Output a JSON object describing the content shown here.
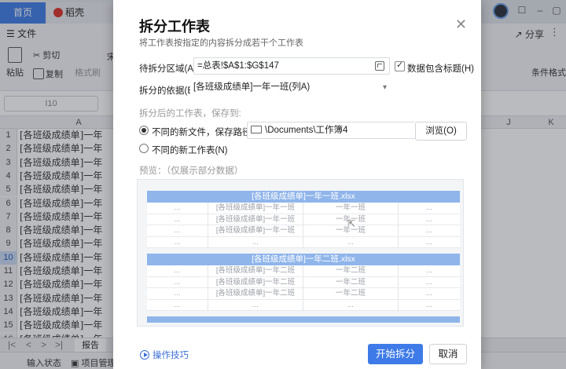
{
  "app": {
    "tabs": [
      {
        "label": "首页"
      },
      {
        "label": "稻壳"
      }
    ],
    "menu": {
      "file": "文件",
      "share": "分享"
    },
    "ribbon": {
      "paste": "粘贴",
      "cut": "剪切",
      "copy": "复制",
      "format_painter": "格式刷",
      "font_partial": "宋",
      "conditional_format": "条件格式"
    },
    "name_box": "I10",
    "columns": [
      "A",
      "J",
      "K"
    ],
    "rows": [
      {
        "n": "1",
        "v": "[各班级成绩单]一年"
      },
      {
        "n": "2",
        "v": "[各班级成绩单]一年"
      },
      {
        "n": "3",
        "v": "[各班级成绩单]一年"
      },
      {
        "n": "4",
        "v": "[各班级成绩单]一年"
      },
      {
        "n": "5",
        "v": "[各班级成绩单]一年"
      },
      {
        "n": "6",
        "v": "[各班级成绩单]一年"
      },
      {
        "n": "7",
        "v": "[各班级成绩单]一年"
      },
      {
        "n": "8",
        "v": "[各班级成绩单]一年"
      },
      {
        "n": "9",
        "v": "[各班级成绩单]一年"
      },
      {
        "n": "10",
        "v": "[各班级成绩单]一年"
      },
      {
        "n": "11",
        "v": "[各班级成绩单]一年"
      },
      {
        "n": "12",
        "v": "[各班级成绩单]一年"
      },
      {
        "n": "13",
        "v": "[各班级成绩单]一年"
      },
      {
        "n": "14",
        "v": "[各班级成绩单]一年"
      },
      {
        "n": "15",
        "v": "[各班级成绩单]一年"
      },
      {
        "n": "16",
        "v": "[各班级成绩单]一年"
      }
    ],
    "sheet_tab": "报告",
    "status": {
      "input_state": "输入状态",
      "project": "项目管理"
    }
  },
  "dialog": {
    "title": "拆分工作表",
    "subtitle": "将工作表按指定的内容拆分成若干个工作表",
    "range_label": "待拆分区域(A):",
    "range_value": "=总表!$A$1:$G$147",
    "header_checkbox": "数据包含标题(H)",
    "header_checked": true,
    "basis_label": "拆分的依据(B):",
    "basis_value": "[各班级成绩单]一年一班(列A)",
    "save_section": "拆分后的工作表，保存到:",
    "option_new_file": "不同的新文件，保存路径(P)",
    "path_value": "\\Documents\\工作簿4",
    "browse": "浏览(O)",
    "option_new_sheet": "不同的新工作表(N)",
    "selected_option": "new_file",
    "preview_label": "预览：（仅展示部分数据）",
    "preview_files": [
      {
        "name": "[各班级成绩单]一年一班.xlsx",
        "rows": [
          [
            "...",
            "[各班级成绩单]一年一班",
            "一年一班",
            "..."
          ],
          [
            "...",
            "[各班级成绩单]一年一班",
            "一年一班",
            "..."
          ],
          [
            "...",
            "[各班级成绩单]一年一班",
            "一年一班",
            "..."
          ],
          [
            "...",
            "...",
            "...",
            "..."
          ]
        ]
      },
      {
        "name": "[各班级成绩单]一年二班.xlsx",
        "rows": [
          [
            "...",
            "[各班级成绩单]一年二班",
            "一年二班",
            "..."
          ],
          [
            "...",
            "[各班级成绩单]一年二班",
            "一年二班",
            "..."
          ],
          [
            "...",
            "[各班级成绩单]一年二班",
            "一年二班",
            "..."
          ],
          [
            "...",
            "...",
            "...",
            "..."
          ]
        ]
      }
    ],
    "tips": "操作技巧",
    "start": "开始拆分",
    "cancel": "取消"
  }
}
